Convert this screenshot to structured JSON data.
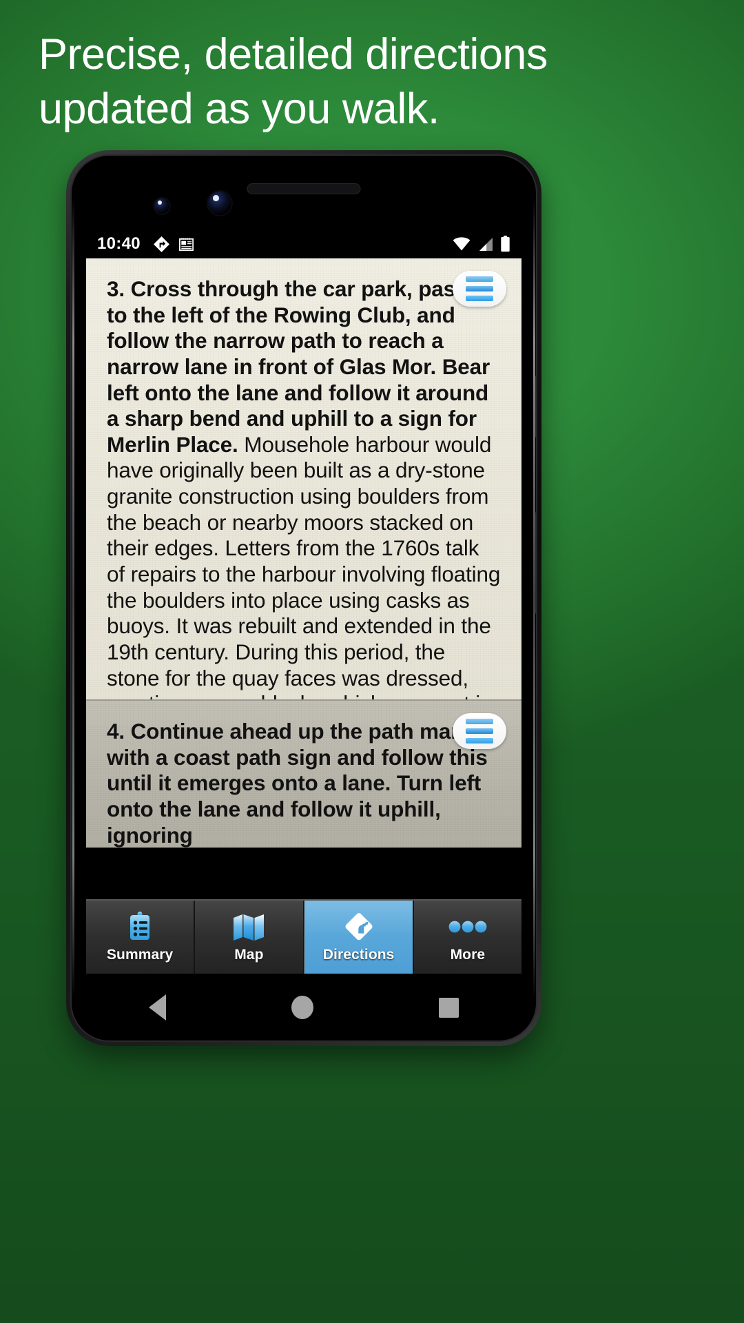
{
  "promo": {
    "headline": "Precise, detailed directions\nupdated as you walk.",
    "background_color": "#2d8a3a",
    "text_color": "#ffffff"
  },
  "phone": {
    "status_bar": {
      "time": "10:40",
      "left_icons": [
        "navigation-badge-icon",
        "note-icon"
      ],
      "right_icons": [
        "wifi-icon",
        "cell-signal-icon",
        "battery-icon"
      ]
    },
    "android_nav": {
      "back": "back-icon",
      "home": "home-icon",
      "recents": "recents-icon"
    }
  },
  "directions": {
    "cards": [
      {
        "id": "step-3",
        "instruction": "3. Cross through the car park, passing to the left of the Rowing Club, and follow the narrow path to reach a narrow lane in front of Glas Mor. Bear left onto the lane and follow it around a sharp bend and uphill to a sign for Merlin Place.",
        "description": " Mousehole harbour would have originally been built as a dry-stone granite construction using boulders from the beach or nearby moors stacked on their edges. Letters from the 1760s talk of repairs to the harbour involving floating the boulders into place using casks as buoys. It was rebuilt and extended in the 19th century. During this period, the stone for the quay faces was dressed, creating square blocks which were set in mortar. This was typically backfilled with…",
        "menu_icon": "list-lines-icon",
        "expand_icon": "chevron-right-icon",
        "background_color": "#eceadd"
      },
      {
        "id": "step-4",
        "instruction": "4. Continue ahead up the path marked with a coast path sign and follow this until it emerges onto a lane. Turn left onto the lane and follow it uphill, ignoring",
        "description": "",
        "menu_icon": "list-lines-icon",
        "background_color": "#b9b6ab"
      }
    ]
  },
  "tabbar": {
    "active_color": "#59a7da",
    "tabs": [
      {
        "label": "Summary",
        "icon": "clipboard-icon",
        "active": false
      },
      {
        "label": "Map",
        "icon": "map-icon",
        "active": false
      },
      {
        "label": "Directions",
        "icon": "directions-icon",
        "active": true
      },
      {
        "label": "More",
        "icon": "ellipsis-icon",
        "active": false
      }
    ]
  }
}
